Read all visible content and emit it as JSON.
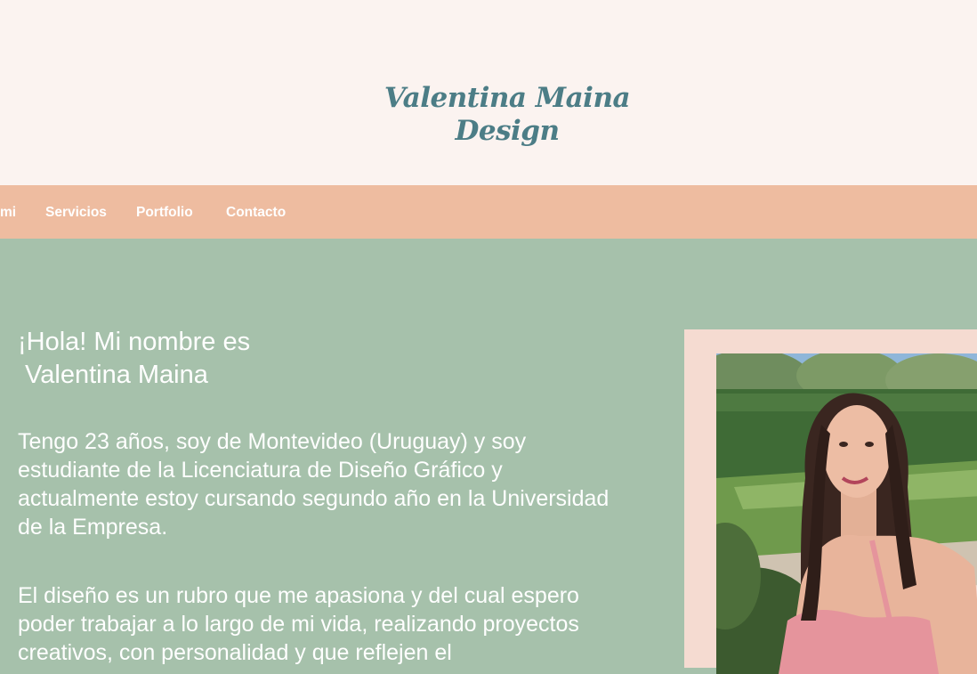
{
  "header": {
    "logo_line1": "Valentina Maina",
    "logo_line2": "Design"
  },
  "nav": {
    "items": [
      {
        "label": "mi"
      },
      {
        "label": "Servicios"
      },
      {
        "label": "Portfolio"
      },
      {
        "label": "Contacto"
      }
    ]
  },
  "hero": {
    "title_line1": "¡Hola! Mi nombre es",
    "title_line2": " Valentina Maina",
    "paragraph1": "Tengo 23 años, soy de Montevideo (Uruguay) y soy estudiante de la Licenciatura de Diseño Gráfico y actualmente estoy cursando segundo año en la Universidad de la Empresa.",
    "paragraph2": "El diseño es un rubro que me apasiona y del cual espero poder trabajar a lo largo de mi vida, realizando proyectos creativos, con personalidad y que reflejen el"
  },
  "colors": {
    "header_bg": "#fbf3f0",
    "logo": "#4c7d86",
    "nav_bg": "#eebca0",
    "hero_bg": "#a6c1ab",
    "photo_frame": "#f5dbd1",
    "text": "#ffffff"
  }
}
